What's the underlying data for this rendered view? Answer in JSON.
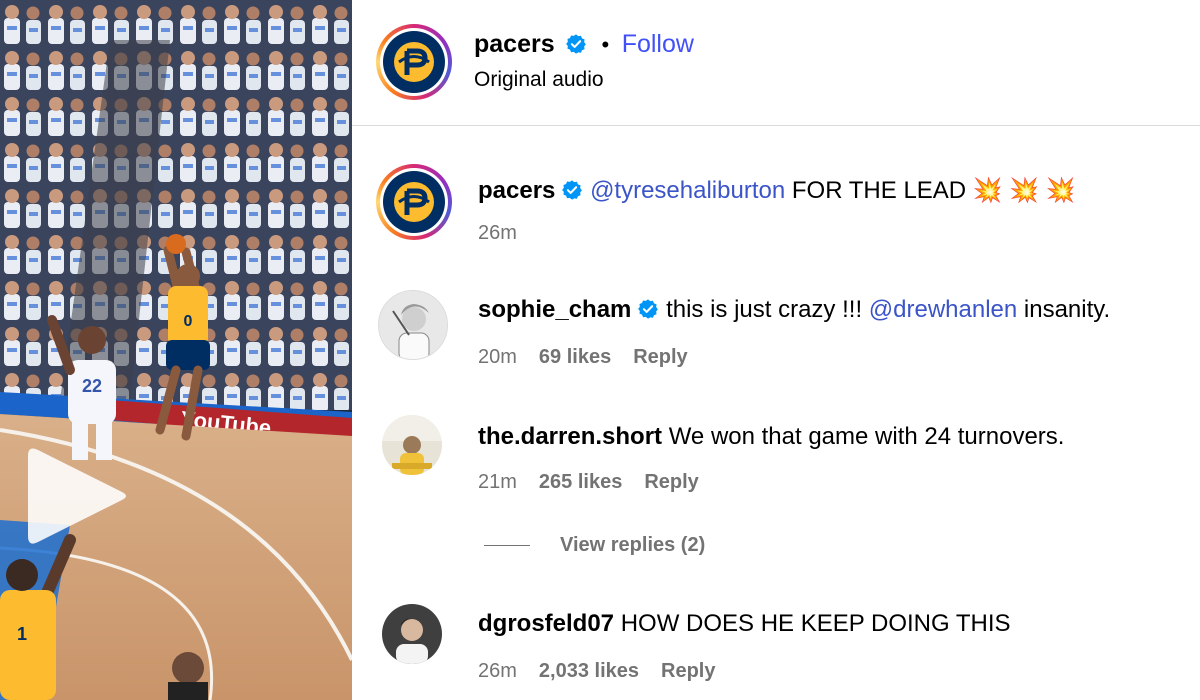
{
  "header": {
    "account": "pacers",
    "separator": "•",
    "follow_label": "Follow",
    "audio": "Original audio"
  },
  "caption": {
    "username": "pacers",
    "mention": "@tyresehaliburton",
    "text": "FOR THE LEAD",
    "emoji": "💥 💥 💥",
    "time": "26m"
  },
  "comments": [
    {
      "username": "sophie_cham",
      "text_before": "this is just crazy !!!",
      "mention": "@drewhanlen",
      "text_after": "insanity.",
      "time": "20m",
      "likes": "69 likes",
      "reply": "Reply"
    },
    {
      "username": "the.darren.short",
      "text": "We won that game with 24 turnovers.",
      "time": "21m",
      "likes": "265 likes",
      "reply": "Reply",
      "view_replies": "View replies (2)"
    },
    {
      "username": "dgrosfeld07",
      "text": "HOW DOES HE KEEP DOING THIS",
      "time": "26m",
      "likes": "2,033 likes",
      "reply": "Reply"
    }
  ],
  "video": {
    "banner_text": "YouTube",
    "jersey_home": "0",
    "jersey_away": "22",
    "jersey_front": "1"
  },
  "colors": {
    "link": "#3b54c8",
    "follow": "#4150f7",
    "verified": "#0095f6",
    "muted": "#737373",
    "pacers_navy": "#002d62",
    "pacers_gold": "#fdbb30"
  }
}
